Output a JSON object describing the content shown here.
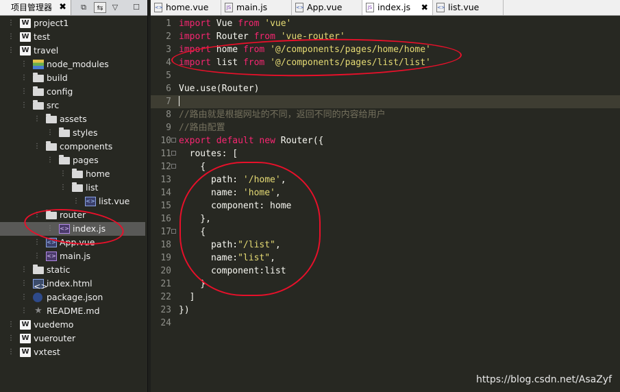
{
  "project_panel": {
    "tab_label": "项目管理器",
    "tab_close": "✖",
    "toolbar_icons": [
      "copy-icon",
      "link-toggle-icon",
      "menu-triangle-icon",
      "maximize-icon"
    ],
    "tree": [
      {
        "label": "project1",
        "icon": "w-project-icon",
        "depth": 0,
        "selected": false
      },
      {
        "label": "test",
        "icon": "w-project-icon",
        "depth": 0,
        "selected": false
      },
      {
        "label": "travel",
        "icon": "w-project-icon",
        "depth": 0,
        "selected": false
      },
      {
        "label": "node_modules",
        "icon": "library-icon",
        "depth": 1,
        "selected": false
      },
      {
        "label": "build",
        "icon": "folder-icon",
        "depth": 1,
        "selected": false
      },
      {
        "label": "config",
        "icon": "folder-icon",
        "depth": 1,
        "selected": false
      },
      {
        "label": "src",
        "icon": "folder-icon",
        "depth": 1,
        "selected": false
      },
      {
        "label": "assets",
        "icon": "folder-icon",
        "depth": 2,
        "selected": false
      },
      {
        "label": "styles",
        "icon": "folder-icon",
        "depth": 3,
        "selected": false
      },
      {
        "label": "components",
        "icon": "folder-icon",
        "depth": 2,
        "selected": false
      },
      {
        "label": "pages",
        "icon": "folder-icon",
        "depth": 3,
        "selected": false
      },
      {
        "label": "home",
        "icon": "folder-icon",
        "depth": 4,
        "selected": false
      },
      {
        "label": "list",
        "icon": "folder-icon",
        "depth": 4,
        "selected": false
      },
      {
        "label": "list.vue",
        "icon": "vue-file-icon",
        "depth": 5,
        "selected": false
      },
      {
        "label": "router",
        "icon": "folder-icon",
        "depth": 2,
        "selected": false
      },
      {
        "label": "index.js",
        "icon": "js-file-icon",
        "depth": 3,
        "selected": true
      },
      {
        "label": "App.vue",
        "icon": "vue-file-icon",
        "depth": 2,
        "selected": false
      },
      {
        "label": "main.js",
        "icon": "js-file-icon",
        "depth": 2,
        "selected": false
      },
      {
        "label": "static",
        "icon": "folder-icon",
        "depth": 1,
        "selected": false
      },
      {
        "label": "index.html",
        "icon": "html-file-icon",
        "depth": 1,
        "selected": false
      },
      {
        "label": "package.json",
        "icon": "json-file-icon",
        "depth": 1,
        "selected": false
      },
      {
        "label": "README.md",
        "icon": "markdown-file-icon",
        "depth": 1,
        "selected": false
      },
      {
        "label": "vuedemo",
        "icon": "w-project-icon",
        "depth": 0,
        "selected": false
      },
      {
        "label": "vuerouter",
        "icon": "w-project-icon",
        "depth": 0,
        "selected": false
      },
      {
        "label": "vxtest",
        "icon": "w-project-icon",
        "depth": 0,
        "selected": false
      }
    ]
  },
  "editor": {
    "tabs": [
      {
        "label": "home.vue",
        "icon": "vue-file-icon",
        "active": false
      },
      {
        "label": "main.js",
        "icon": "js-file-icon",
        "active": false
      },
      {
        "label": "App.vue",
        "icon": "vue-file-icon",
        "active": false
      },
      {
        "label": "index.js",
        "icon": "js-file-icon",
        "active": true
      },
      {
        "label": "list.vue",
        "icon": "vue-file-icon",
        "active": false
      }
    ],
    "tab_close": "✖",
    "current_line": 7,
    "lines": [
      {
        "n": "1",
        "tokens": [
          [
            "k",
            "import"
          ],
          [
            "p",
            " Vue "
          ],
          [
            "k",
            "from"
          ],
          [
            "p",
            " "
          ],
          [
            "s",
            "'vue'"
          ]
        ]
      },
      {
        "n": "2",
        "tokens": [
          [
            "k",
            "import"
          ],
          [
            "p",
            " Router "
          ],
          [
            "k",
            "from"
          ],
          [
            "p",
            " "
          ],
          [
            "s",
            "'vue-router'"
          ]
        ]
      },
      {
        "n": "3",
        "tokens": [
          [
            "k",
            "import"
          ],
          [
            "p",
            " home "
          ],
          [
            "k",
            "from"
          ],
          [
            "p",
            " "
          ],
          [
            "s",
            "'@/components/pages/home/home'"
          ]
        ]
      },
      {
        "n": "4",
        "tokens": [
          [
            "k",
            "import"
          ],
          [
            "p",
            " list "
          ],
          [
            "k",
            "from"
          ],
          [
            "p",
            " "
          ],
          [
            "s",
            "'@/components/pages/list/list'"
          ]
        ]
      },
      {
        "n": "5",
        "tokens": []
      },
      {
        "n": "6",
        "tokens": [
          [
            "p",
            "Vue.use(Router)"
          ]
        ]
      },
      {
        "n": "7",
        "tokens": [],
        "caret": true
      },
      {
        "n": "8",
        "tokens": [
          [
            "c",
            "//路由就是根据网址的不同，返回不同的内容给用户"
          ]
        ]
      },
      {
        "n": "9",
        "tokens": [
          [
            "c",
            "//路由配置"
          ]
        ]
      },
      {
        "n": "10",
        "fold": true,
        "tokens": [
          [
            "k",
            "export"
          ],
          [
            "p",
            " "
          ],
          [
            "k",
            "default"
          ],
          [
            "p",
            " "
          ],
          [
            "k",
            "new"
          ],
          [
            "p",
            " Router({"
          ]
        ]
      },
      {
        "n": "11",
        "fold": true,
        "tokens": [
          [
            "p",
            "  routes: ["
          ]
        ]
      },
      {
        "n": "12",
        "fold": true,
        "tokens": [
          [
            "p",
            "    {"
          ]
        ]
      },
      {
        "n": "13",
        "tokens": [
          [
            "p",
            "      path: "
          ],
          [
            "s",
            "'/home'"
          ],
          [
            "p",
            ","
          ]
        ]
      },
      {
        "n": "14",
        "tokens": [
          [
            "p",
            "      name: "
          ],
          [
            "s",
            "'home'"
          ],
          [
            "p",
            ","
          ]
        ]
      },
      {
        "n": "15",
        "tokens": [
          [
            "p",
            "      component: home"
          ]
        ]
      },
      {
        "n": "16",
        "tokens": [
          [
            "p",
            "    },"
          ]
        ]
      },
      {
        "n": "17",
        "fold": true,
        "tokens": [
          [
            "p",
            "    {"
          ]
        ]
      },
      {
        "n": "18",
        "tokens": [
          [
            "p",
            "      path:"
          ],
          [
            "s",
            "\"/list\""
          ],
          [
            "p",
            ","
          ]
        ]
      },
      {
        "n": "19",
        "tokens": [
          [
            "p",
            "      name:"
          ],
          [
            "s",
            "\"list\""
          ],
          [
            "p",
            ","
          ]
        ]
      },
      {
        "n": "20",
        "tokens": [
          [
            "p",
            "      component:list"
          ]
        ]
      },
      {
        "n": "21",
        "tokens": [
          [
            "p",
            "    }"
          ]
        ]
      },
      {
        "n": "22",
        "tokens": [
          [
            "p",
            "  ]"
          ]
        ]
      },
      {
        "n": "23",
        "tokens": [
          [
            "p",
            "})"
          ]
        ]
      },
      {
        "n": "24",
        "tokens": []
      }
    ]
  },
  "watermark": "https://blog.csdn.net/AsaZyf",
  "colors": {
    "keyword": "#f92672",
    "string": "#e6db74",
    "comment": "#75715e",
    "annotation": "#e8102a"
  }
}
